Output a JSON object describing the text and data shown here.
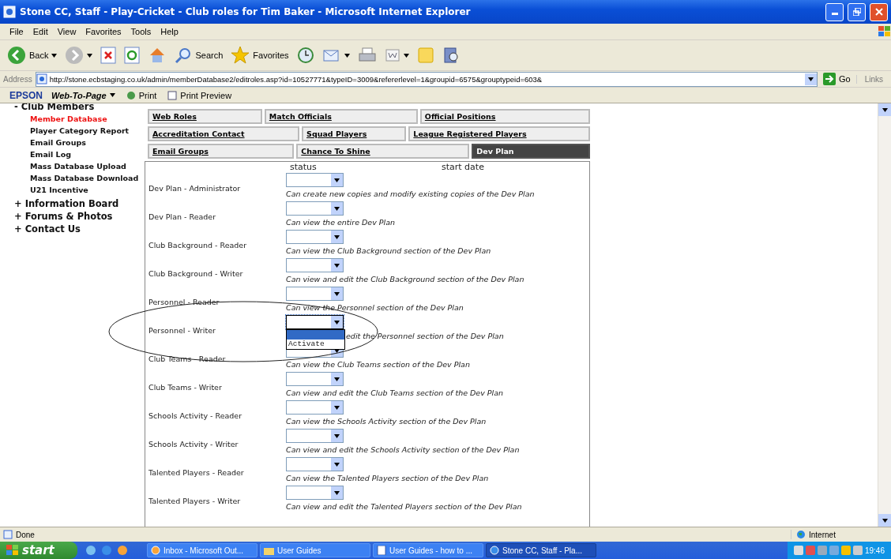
{
  "window": {
    "title": "Stone CC, Staff - Play-Cricket - Club roles for Tim Baker - Microsoft Internet Explorer"
  },
  "menu": [
    "File",
    "Edit",
    "View",
    "Favorites",
    "Tools",
    "Help"
  ],
  "toolbar": [
    {
      "kind": "back",
      "label": "Back"
    },
    {
      "kind": "forward"
    },
    {
      "kind": "stop"
    },
    {
      "kind": "refresh"
    },
    {
      "kind": "home"
    },
    {
      "kind": "search",
      "label": "Search"
    },
    {
      "kind": "favorites",
      "label": "Favorites"
    },
    {
      "kind": "history"
    },
    {
      "kind": "mail"
    },
    {
      "kind": "print"
    },
    {
      "kind": "edit"
    },
    {
      "kind": "folder"
    },
    {
      "kind": "research"
    }
  ],
  "address": {
    "label": "Address",
    "value": "http://stone.ecbstaging.co.uk/admin/memberDatabase2/editroles.asp?id=10527771&typeID=3009&refererlevel=1&groupid=6575&grouptypeid=603&",
    "go": "Go",
    "links": "Links"
  },
  "epson_bar": {
    "brand": "EPSON",
    "web_to_page": "Web-To-Page",
    "print": "Print",
    "print_preview": "Print Preview"
  },
  "sidebar": [
    {
      "label": "- Club Members",
      "children": [
        {
          "label": "Member Database",
          "selected": true
        },
        {
          "label": "Player Category Report",
          "selected": false
        },
        {
          "label": "Email Groups",
          "selected": false
        },
        {
          "label": "Email Log",
          "selected": false
        },
        {
          "label": "Mass Database Upload",
          "selected": false
        },
        {
          "label": "Mass Database Download",
          "selected": false
        },
        {
          "label": "U21 Incentive",
          "selected": false
        }
      ]
    },
    {
      "label": "+ Information Board"
    },
    {
      "label": "+ Forums & Photos"
    },
    {
      "label": "+ Contact Us"
    }
  ],
  "tabs": [
    [
      {
        "label": "Web Roles",
        "selected": false
      },
      {
        "label": "Match Officials",
        "selected": false
      },
      {
        "label": "Official Positions",
        "selected": false
      }
    ],
    [
      {
        "label": "Accreditation Contact",
        "selected": false
      },
      {
        "label": "Squad Players",
        "selected": false
      },
      {
        "label": "League Registered Players",
        "selected": false
      }
    ],
    [
      {
        "label": "Email Groups",
        "selected": false
      },
      {
        "label": "Chance To Shine",
        "selected": false
      },
      {
        "label": "Dev Plan",
        "selected": true
      }
    ]
  ],
  "panel": {
    "headers": [
      "status",
      "start date"
    ],
    "dropdown_options": [
      "Activate"
    ],
    "roles": [
      {
        "name": "Dev Plan - Administrator",
        "description": "Can create new copies and modify existing copies of the Dev Plan",
        "open": false
      },
      {
        "name": "Dev Plan - Reader",
        "description": "Can view the entire Dev Plan",
        "open": false
      },
      {
        "name": "Club Background - Reader",
        "description": "Can view the Club Background section of the Dev Plan",
        "open": false
      },
      {
        "name": "Club Background - Writer",
        "description": "Can view and edit the Club Background section of the Dev Plan",
        "open": false
      },
      {
        "name": "Personnel - Reader",
        "description": "Can view the Personnel section of the Dev Plan",
        "open": false
      },
      {
        "name": "Personnel - Writer",
        "description": "edit the Personnel section of the Dev Plan",
        "open": true
      },
      {
        "name": "Club Teams - Reader",
        "description": "Can view the Club Teams section of the Dev Plan",
        "open": false
      },
      {
        "name": "Club Teams - Writer",
        "description": "Can view and edit the Club Teams section of the Dev Plan",
        "open": false
      },
      {
        "name": "Schools Activity - Reader",
        "description": "Can view the Schools Activity section of the Dev Plan",
        "open": false
      },
      {
        "name": "Schools Activity - Writer",
        "description": "Can view and edit the Schools Activity section of the Dev Plan",
        "open": false
      },
      {
        "name": "Talented Players - Reader",
        "description": "Can view the Talented Players section of the Dev Plan",
        "open": false
      },
      {
        "name": "Talented Players - Writer",
        "description": "Can view and edit the Talented Players section of the Dev Plan",
        "open": false
      }
    ]
  },
  "status_bar": {
    "text": "Done",
    "zone": "Internet"
  },
  "taskbar": {
    "start": "start",
    "tasks": [
      {
        "label": "Inbox - Microsoft Out...",
        "kind": "mail",
        "selected": false
      },
      {
        "label": "User Guides",
        "kind": "folder",
        "selected": false
      },
      {
        "label": "User Guides - how to ...",
        "kind": "doc",
        "selected": false
      },
      {
        "label": "Stone CC, Staff - Pla...",
        "kind": "browser",
        "selected": true
      }
    ],
    "clock": "19:46"
  }
}
